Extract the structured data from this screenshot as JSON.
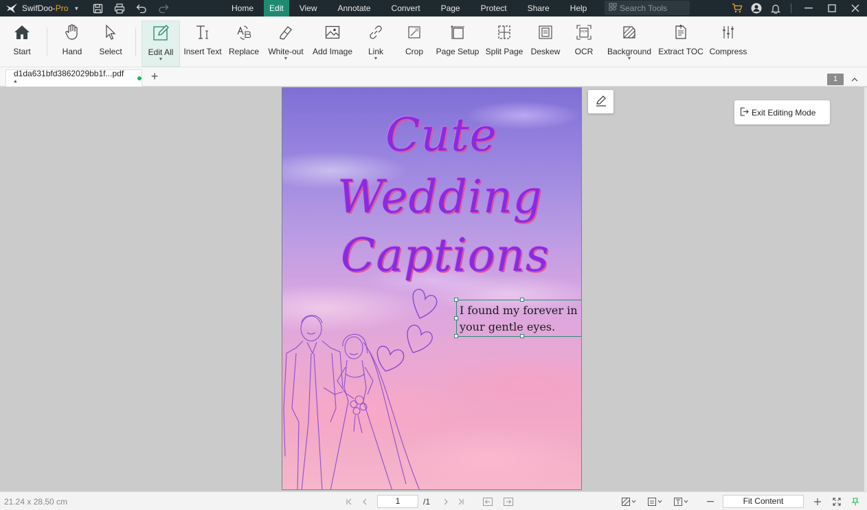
{
  "app": {
    "name": "SwifDoo-",
    "edition": "Pro"
  },
  "menu": [
    {
      "label": "Home",
      "active": false
    },
    {
      "label": "Edit",
      "active": true
    },
    {
      "label": "View",
      "active": false
    },
    {
      "label": "Annotate",
      "active": false
    },
    {
      "label": "Convert",
      "active": false
    },
    {
      "label": "Page",
      "active": false
    },
    {
      "label": "Protect",
      "active": false
    },
    {
      "label": "Share",
      "active": false
    },
    {
      "label": "Help",
      "active": false
    }
  ],
  "search": {
    "placeholder": "Search Tools"
  },
  "toolbar": {
    "start": "Start",
    "hand": "Hand",
    "select": "Select",
    "edit_all": "Edit All",
    "insert_text": "Insert Text",
    "replace": "Replace",
    "white_out": "White-out",
    "add_image": "Add Image",
    "link": "Link",
    "crop": "Crop",
    "page_setup": "Page Setup",
    "split_page": "Split Page",
    "deskew": "Deskew",
    "ocr": "OCR",
    "background": "Background",
    "extract_toc": "Extract TOC",
    "compress": "Compress"
  },
  "tab": {
    "filename": "d1da631bfd3862029bb1f...pdf *",
    "page_count": "1"
  },
  "document": {
    "title_line_1": "Cute",
    "title_line_2": "Wedding",
    "title_line_3": "Captions",
    "caption": "I found my forever in your gentle eyes."
  },
  "floating": {
    "exit_editing": "Exit Editing Mode"
  },
  "status": {
    "dimensions": "21.24 x 28.50 cm",
    "current_page": "1",
    "total_pages": "/1",
    "zoom": "Fit Content"
  },
  "colors": {
    "accent": "#1e8a72",
    "titlebar": "#1f2a30",
    "cart": "#f0a42c"
  }
}
